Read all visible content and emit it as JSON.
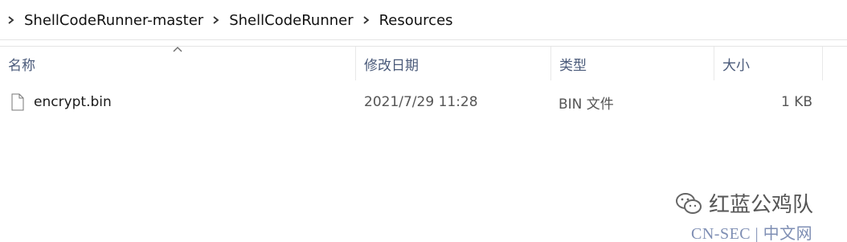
{
  "breadcrumb": {
    "items": [
      {
        "label": "ShellCodeRunner-master"
      },
      {
        "label": "ShellCodeRunner"
      },
      {
        "label": "Resources"
      }
    ]
  },
  "columns": {
    "name": "名称",
    "modified": "修改日期",
    "type": "类型",
    "size": "大小"
  },
  "files": [
    {
      "name": "encrypt.bin",
      "modified": "2021/7/29 11:28",
      "type": "BIN 文件",
      "size": "1 KB"
    }
  ],
  "watermark": {
    "title": "红蓝公鸡队",
    "subtitle": "CN-SEC | 中文网"
  },
  "icons": {
    "breadcrumb_separator": "chevron-right-icon",
    "sort_indicator": "sort-caret-up-icon",
    "file": "file-icon",
    "watermark_logo": "wechat-logo-icon"
  },
  "colors": {
    "header_text": "#4a5a7a",
    "watermark_sub": "#7f8fb4"
  }
}
